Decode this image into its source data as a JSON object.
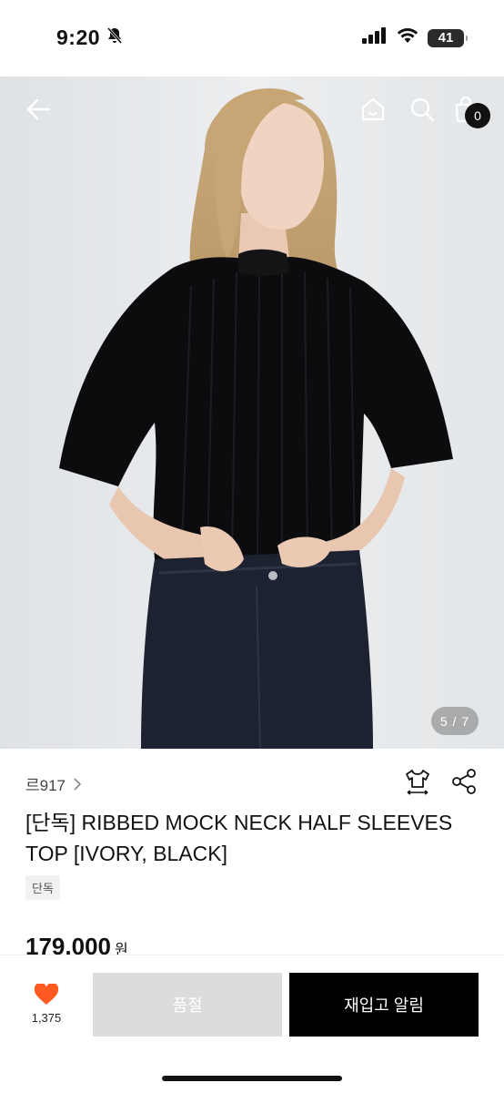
{
  "status_bar": {
    "time": "9:20",
    "battery": "41",
    "icons": [
      "bell-slash-icon",
      "signal-icon",
      "wifi-icon",
      "battery-icon"
    ]
  },
  "nav": {
    "icons": [
      "back-arrow-icon",
      "home-icon",
      "search-icon",
      "shopping-bag-icon"
    ],
    "cart_count": "0"
  },
  "gallery": {
    "indicator": "5 / 7",
    "current": 5,
    "total": 7
  },
  "product": {
    "brand": "르917",
    "title": "[단독] RIBBED MOCK NECK HALF SLEEVES TOP [IVORY, BLACK]",
    "tag": "단독",
    "price": "179,000",
    "price_unit": "원"
  },
  "bottom": {
    "like_count": "1,375",
    "soldout_label": "품절",
    "notify_label": "재입고 알림"
  },
  "colors": {
    "accent": "#ff5a1f",
    "primary": "#000000",
    "disabled": "#dcdcdc"
  }
}
